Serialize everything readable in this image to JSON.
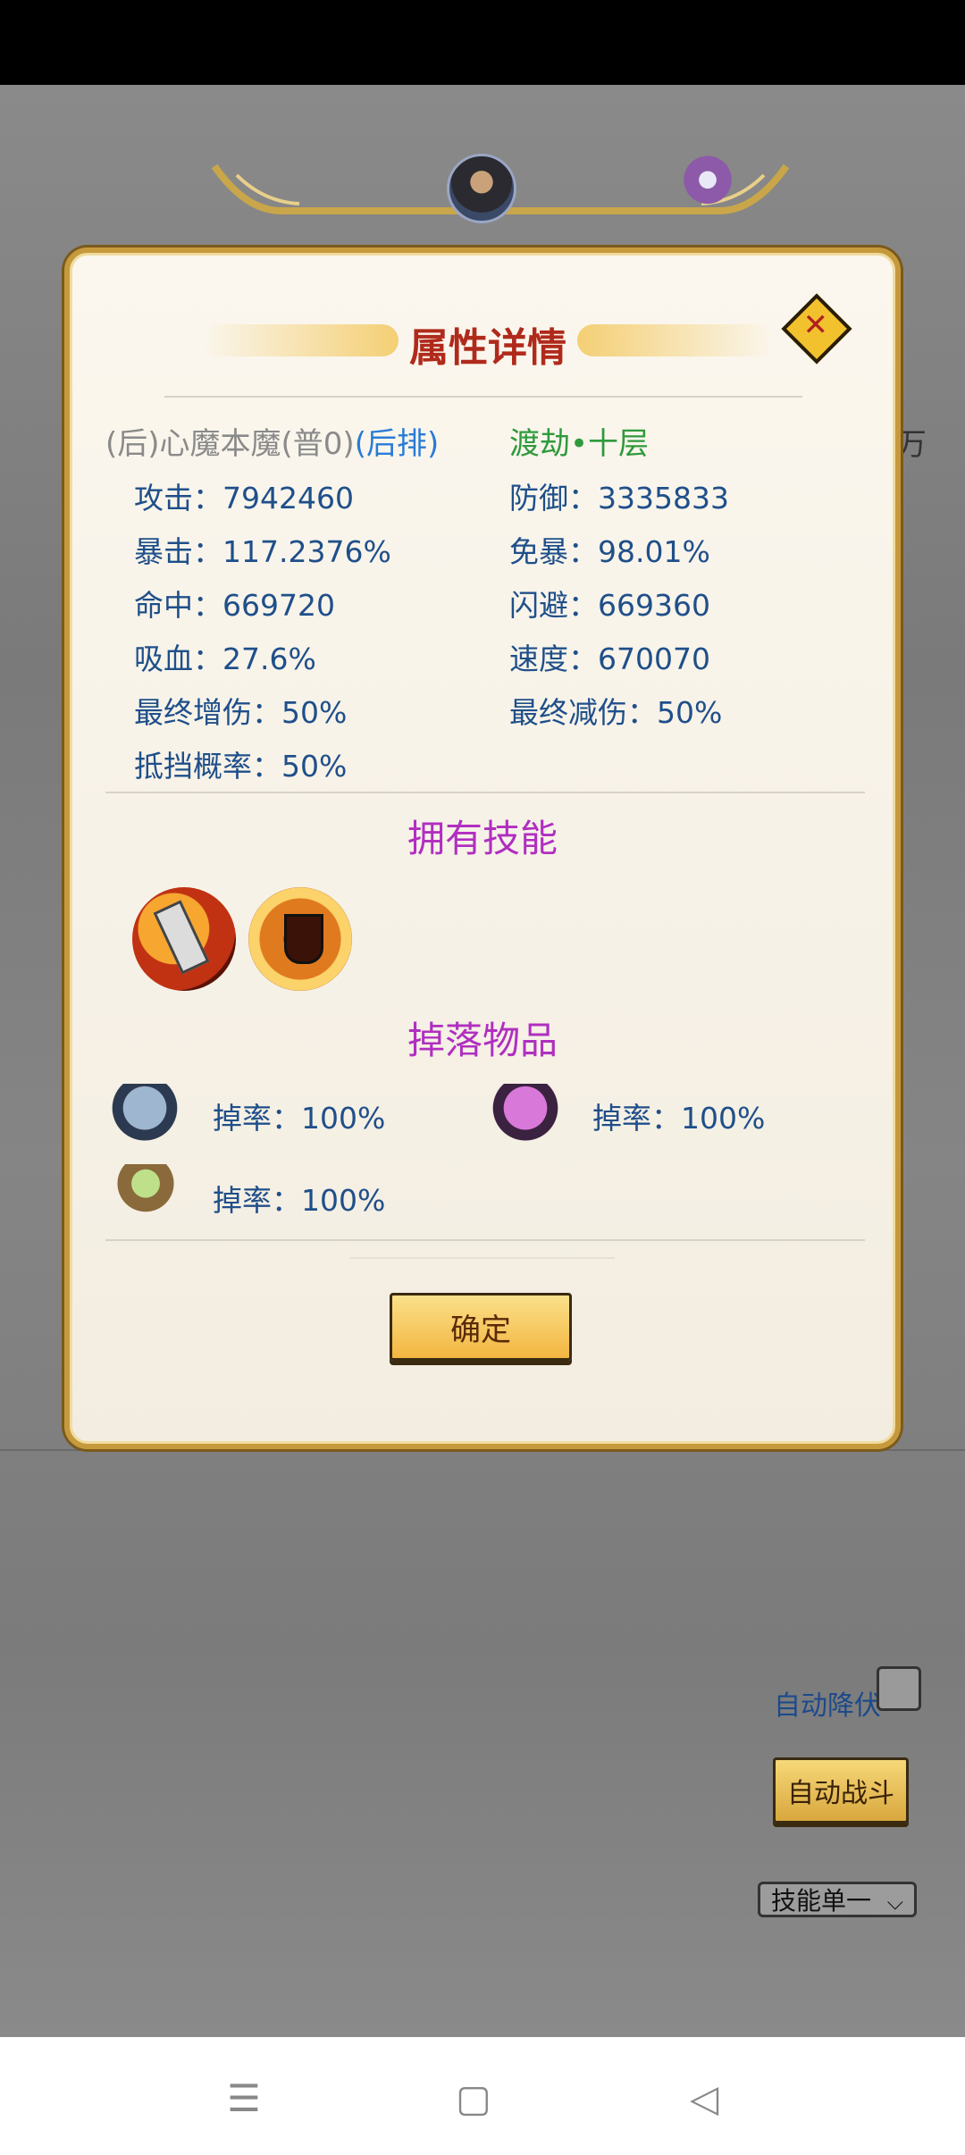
{
  "background": {
    "side_text": "万",
    "auto_surrender_label": "自动降伏",
    "auto_battle_label": "自动战斗",
    "skill_mode_select": "技能单一"
  },
  "dialog": {
    "title": "属性详情",
    "close_icon": "close-icon",
    "enemy": {
      "prefix": "(后)心魔本魔(普0)",
      "position": "(后排)",
      "stage": "渡劫•十层"
    },
    "stats": [
      {
        "label": "攻击：",
        "value": "7942460"
      },
      {
        "label": "防御：",
        "value": "3335833"
      },
      {
        "label": "暴击：",
        "value": "117.2376%"
      },
      {
        "label": "免暴：",
        "value": "98.01%"
      },
      {
        "label": "命中：",
        "value": "669720"
      },
      {
        "label": "闪避：",
        "value": "669360"
      },
      {
        "label": "吸血：",
        "value": "27.6%"
      },
      {
        "label": "速度：",
        "value": "670070"
      },
      {
        "label": "最终增伤：",
        "value": "50%"
      },
      {
        "label": "最终减伤：",
        "value": "50%"
      },
      {
        "label": "抵挡概率：",
        "value": "50%"
      }
    ],
    "skills_title": "拥有技能",
    "skills": [
      "blade-skill-icon",
      "shield-skill-icon"
    ],
    "drops_title": "掉落物品",
    "drops": [
      {
        "icon": "silver-chest-icon",
        "text": "掉率：100%"
      },
      {
        "icon": "purple-chest-icon",
        "text": "掉率：100%"
      },
      {
        "icon": "jade-sack-icon",
        "text": "掉率：100%"
      }
    ],
    "confirm_label": "确定"
  },
  "navbar": {
    "icons": [
      "menu-icon",
      "home-icon",
      "back-icon"
    ]
  }
}
